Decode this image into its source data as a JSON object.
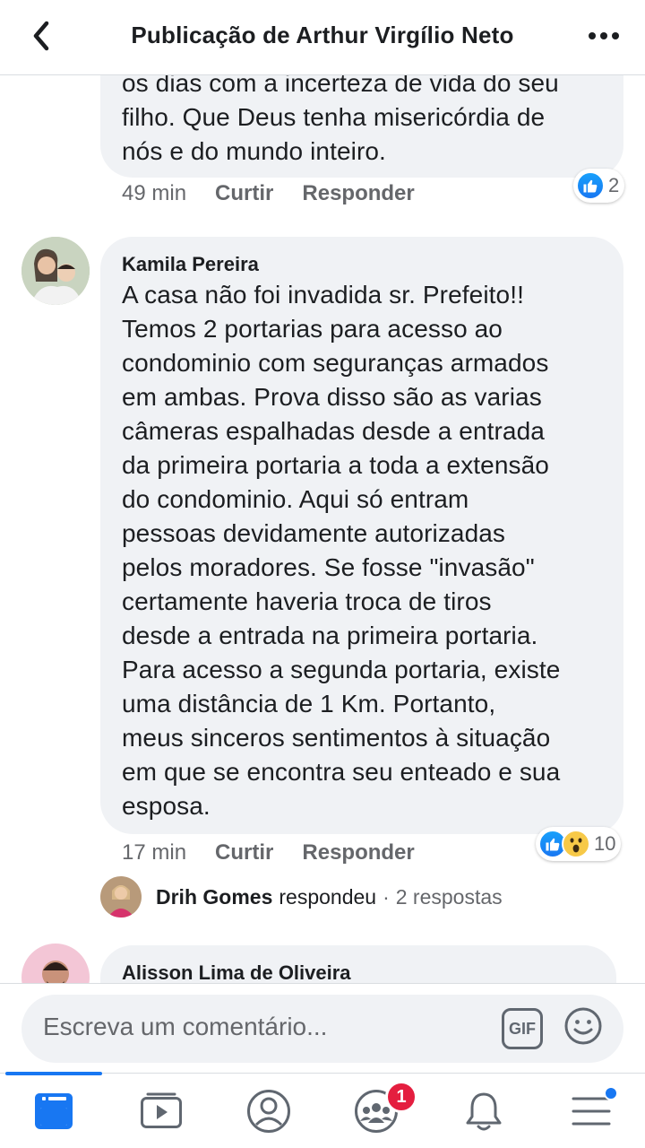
{
  "header": {
    "title": "Publicação de Arthur Virgílio Neto"
  },
  "comments": [
    {
      "partial_text_lines": [
        "os dias com a incerteza de vida do seu",
        "filho. Que Deus tenha misericórdia de",
        "nós e do mundo inteiro."
      ],
      "time": "49 min",
      "like_label": "Curtir",
      "reply_label": "Responder",
      "reaction_count": "2",
      "reactions": [
        "like-icon"
      ]
    },
    {
      "author": "Kamila Pereira",
      "text_lines": [
        "A casa não foi invadida sr. Prefeito!!",
        "Temos 2 portarias para acesso ao",
        "condominio com seguranças armados",
        "em ambas. Prova disso são as varias",
        "câmeras espalhadas desde a entrada",
        "da primeira portaria a toda a extensão",
        "do condominio. Aqui só entram",
        "pessoas devidamente autorizadas",
        "pelos moradores. Se fosse \"invasão\"",
        "certamente haveria troca de tiros",
        "desde a entrada na primeira portaria.",
        "Para acesso a segunda portaria, existe",
        "uma distância de 1 Km. Portanto,",
        "meus sinceros sentimentos à  situação",
        "em que se encontra seu enteado e sua",
        "esposa."
      ],
      "time": "17 min",
      "like_label": "Curtir",
      "reply_label": "Responder",
      "reaction_count": "10",
      "reactions": [
        "like-icon",
        "wow-icon"
      ],
      "reply_summary": {
        "name": "Drih Gomes",
        "action": "respondeu",
        "separator": "·",
        "replies": "2 respostas"
      }
    },
    {
      "author": "Alisson Lima de Oliveira"
    }
  ],
  "composer": {
    "placeholder": "Escreva um comentário...",
    "gif_label": "GIF"
  },
  "bottom_nav": {
    "items": [
      "feed-icon",
      "watch-icon",
      "profile-icon",
      "groups-icon",
      "notifications-icon",
      "menu-icon"
    ],
    "groups_badge": "1",
    "active": "feed-icon"
  },
  "colors": {
    "accent": "#1877f2",
    "bubble": "#f0f2f5",
    "secondary_text": "#65676b",
    "badge": "#e41e3f"
  }
}
